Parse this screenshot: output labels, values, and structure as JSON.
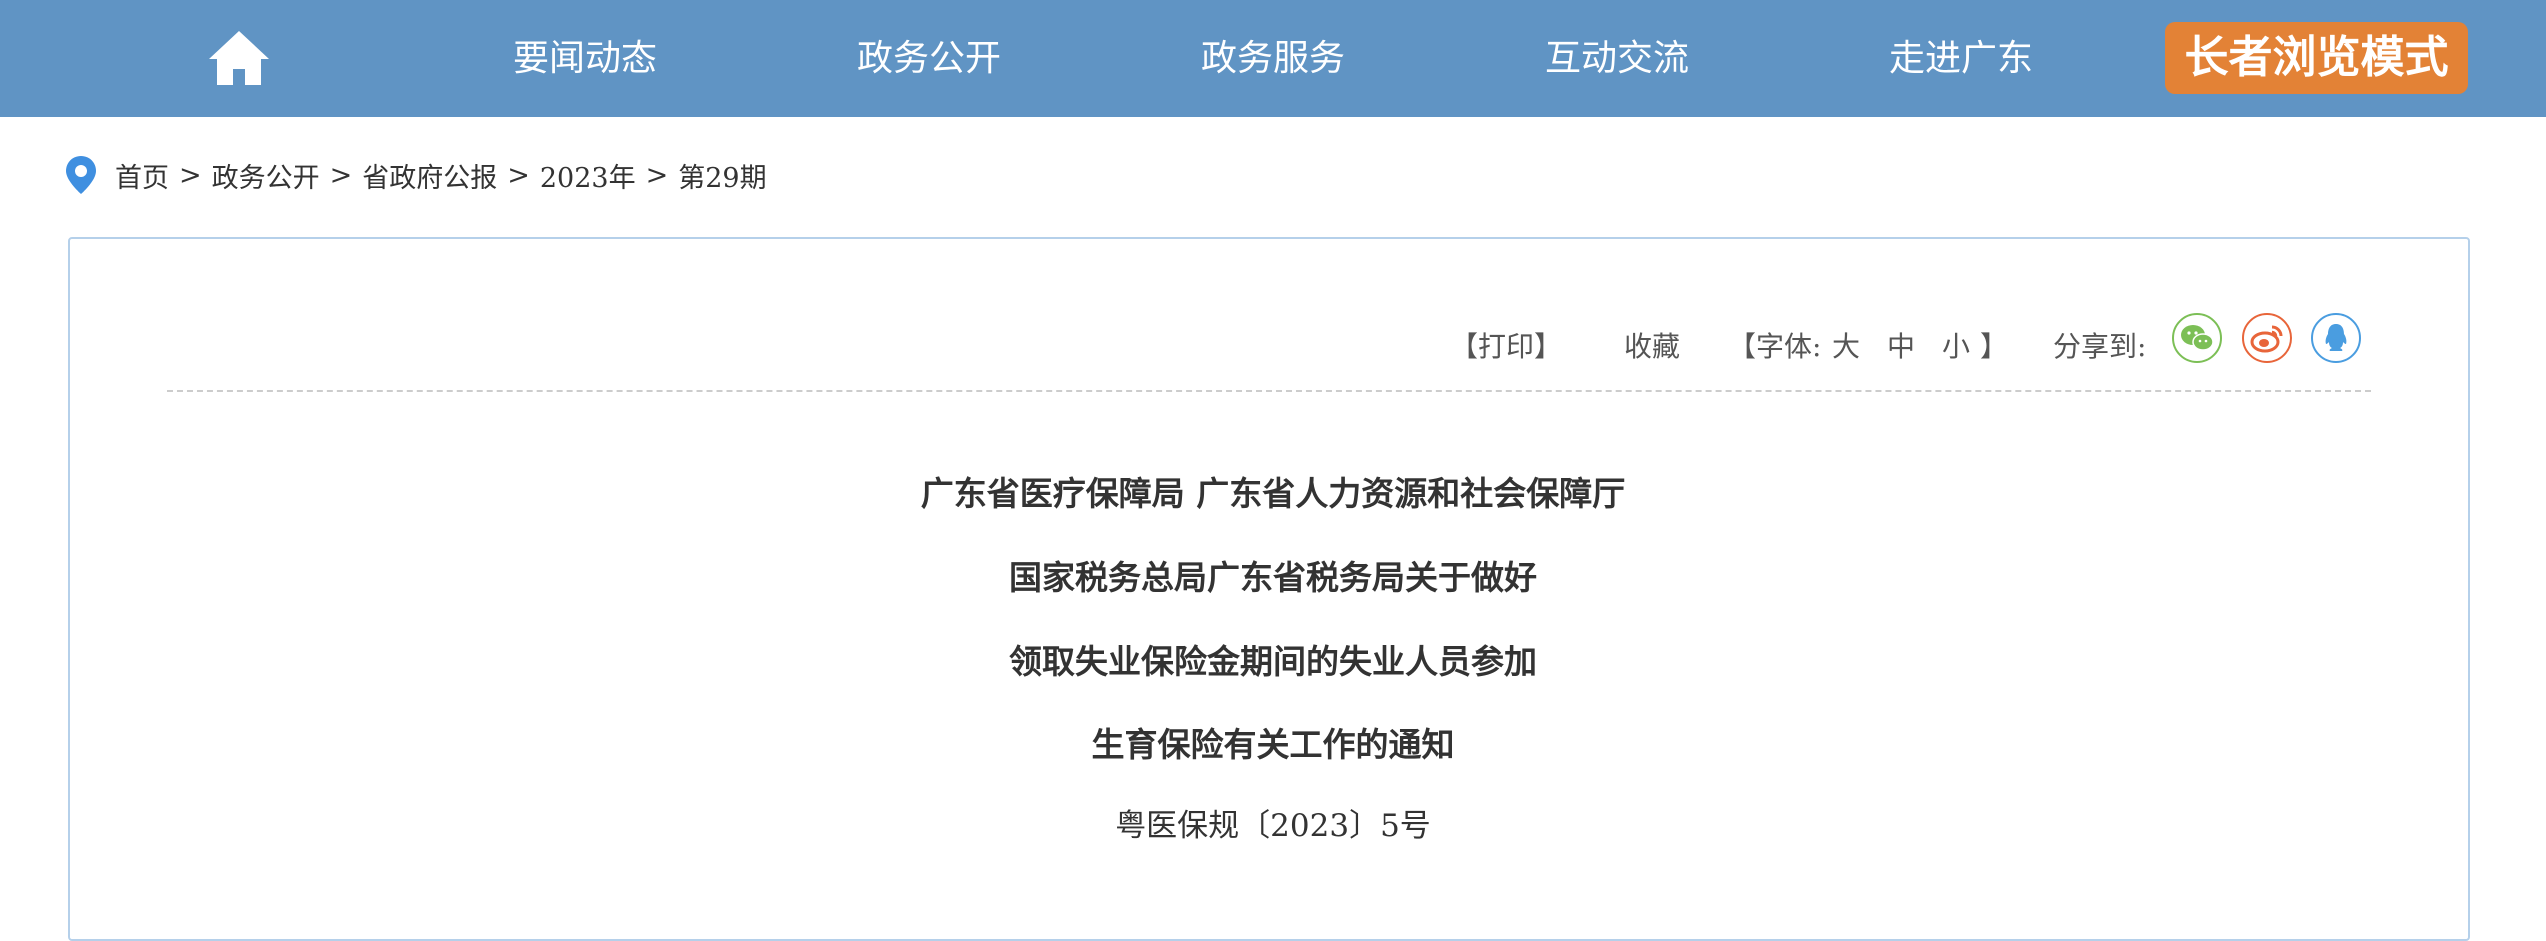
{
  "nav": {
    "home_icon": "home-icon",
    "items": [
      {
        "label": "要闻动态"
      },
      {
        "label": "政务公开"
      },
      {
        "label": "政务服务"
      },
      {
        "label": "互动交流"
      },
      {
        "label": "走进广东"
      }
    ],
    "elder_mode_label": "长者浏览模式",
    "colors": {
      "bar": "#6094c4",
      "elder_button": "#e38236"
    }
  },
  "breadcrumb": {
    "icon": "location-pin-icon",
    "items": [
      {
        "label": "首页"
      },
      {
        "label": "政务公开"
      },
      {
        "label": "省政府公报"
      },
      {
        "label": "2023年"
      },
      {
        "label": "第29期"
      }
    ],
    "separator": ">"
  },
  "tools": {
    "print_label": "【打印】",
    "favorite_label": "收藏",
    "font_prefix": "【字体:",
    "font_large": "大",
    "font_medium": "中",
    "font_small": "小",
    "font_suffix": "】",
    "share_label": "分享到:",
    "share_icons": [
      "wechat-icon",
      "weibo-icon",
      "qq-icon"
    ]
  },
  "article": {
    "title_lines": [
      "广东省医疗保障局 广东省人力资源和社会保障厅",
      "国家税务总局广东省税务局关于做好",
      "领取失业保险金期间的失业人员参加",
      "生育保险有关工作的通知"
    ],
    "doc_number": "粤医保规〔2023〕5号"
  }
}
